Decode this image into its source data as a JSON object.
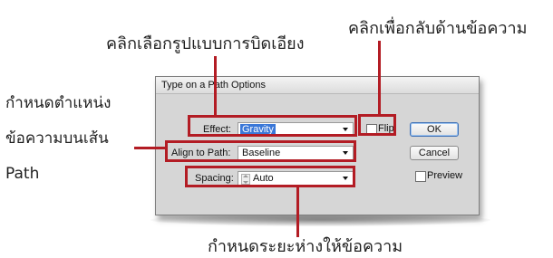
{
  "annotations": {
    "pick_style": "คลิกเลือกรูปแบบการบิดเอียง",
    "flip": "คลิกเพื่อกลับด้านข้อความ",
    "position_line1": "กำหนดตำแหน่ง",
    "position_line2": "ข้อความบนเส้น",
    "position_line3": "Path",
    "spacing": "กำหนดระยะห่างให้ข้อความ"
  },
  "dialog": {
    "title": "Type on a Path Options",
    "effect": {
      "label": "Effect:",
      "value": "Gravity"
    },
    "align": {
      "label": "Align to Path:",
      "value": "Baseline"
    },
    "spacing": {
      "label": "Spacing:",
      "value": "Auto"
    },
    "flip": {
      "label": "Flip",
      "checked": false
    },
    "preview": {
      "label": "Preview",
      "checked": false
    },
    "ok_label": "OK",
    "cancel_label": "Cancel"
  },
  "colors": {
    "annotation_red": "#b31c24",
    "selection_blue": "#3b78d8",
    "dialog_bg": "#d6d6d6"
  }
}
